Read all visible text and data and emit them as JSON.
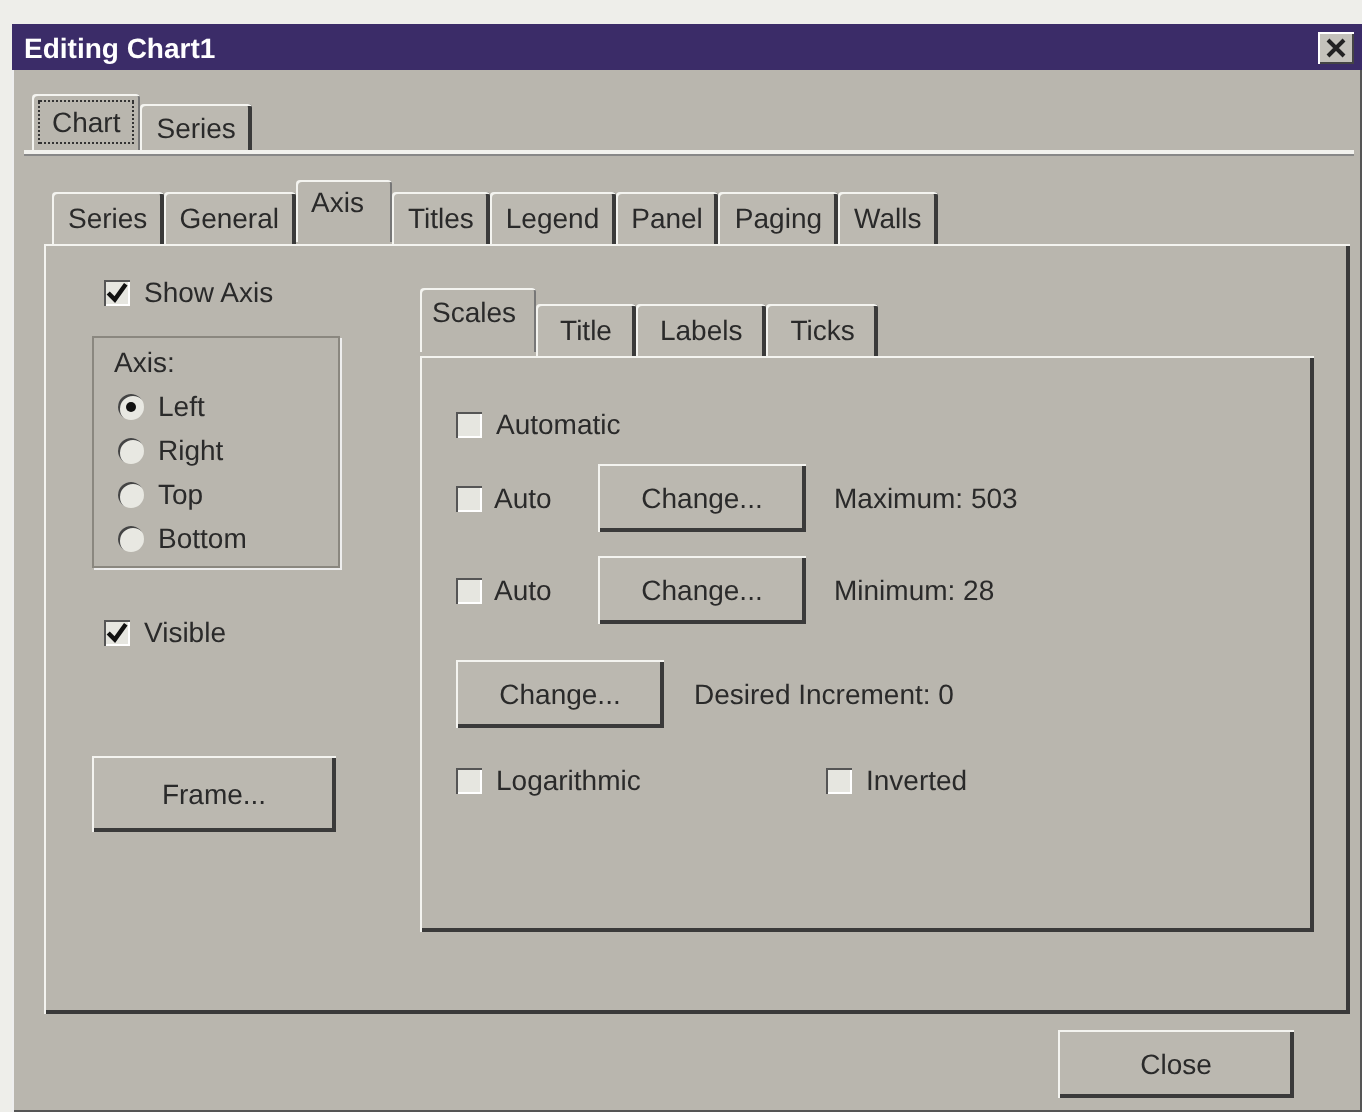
{
  "window": {
    "title": "Editing Chart1"
  },
  "top_tabs": [
    {
      "label": "Chart",
      "selected": true
    },
    {
      "label": "Series",
      "selected": false
    }
  ],
  "tabs": [
    {
      "label": "Series",
      "selected": false
    },
    {
      "label": "General",
      "selected": false
    },
    {
      "label": "Axis",
      "selected": true
    },
    {
      "label": "Titles",
      "selected": false
    },
    {
      "label": "Legend",
      "selected": false
    },
    {
      "label": "Panel",
      "selected": false
    },
    {
      "label": "Paging",
      "selected": false
    },
    {
      "label": "Walls",
      "selected": false
    }
  ],
  "show_axis": {
    "label": "Show Axis",
    "checked": true
  },
  "axis_group": {
    "label": "Axis:",
    "options": [
      {
        "label": "Left",
        "selected": true
      },
      {
        "label": "Right",
        "selected": false
      },
      {
        "label": "Top",
        "selected": false
      },
      {
        "label": "Bottom",
        "selected": false
      }
    ]
  },
  "visible": {
    "label": "Visible",
    "checked": true
  },
  "frame_button": "Frame...",
  "sub_tabs": [
    {
      "label": "Scales",
      "selected": true
    },
    {
      "label": "Title",
      "selected": false
    },
    {
      "label": "Labels",
      "selected": false
    },
    {
      "label": "Ticks",
      "selected": false
    }
  ],
  "automatic": {
    "label": "Automatic",
    "checked": false
  },
  "maximum": {
    "auto_label": "Auto",
    "checked": false,
    "button": "Change...",
    "text": "Maximum: 503"
  },
  "minimum": {
    "auto_label": "Auto",
    "checked": false,
    "button": "Change...",
    "text": "Minimum: 28"
  },
  "increment": {
    "button": "Change...",
    "text": "Desired Increment: 0"
  },
  "logarithmic": {
    "label": "Logarithmic",
    "checked": false
  },
  "inverted": {
    "label": "Inverted",
    "checked": false
  },
  "close_button": "Close"
}
